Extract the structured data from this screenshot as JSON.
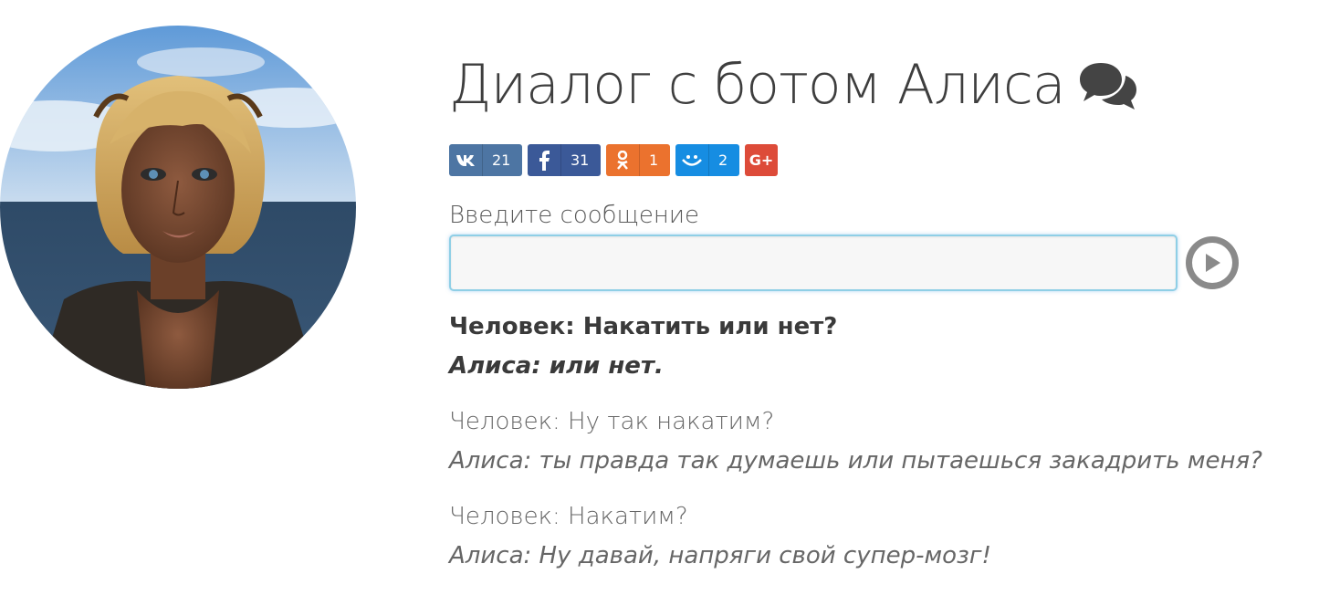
{
  "header": {
    "title": "Диалог с ботом Алиса",
    "title_icon": "comments-icon"
  },
  "share": [
    {
      "network": "vk",
      "icon": "vk-icon",
      "count": "21",
      "color": "#4d75a3"
    },
    {
      "network": "facebook",
      "icon": "facebook-icon",
      "count": "31",
      "color": "#3b5998"
    },
    {
      "network": "odnoklassniki",
      "icon": "odnoklassniki-icon",
      "count": "1",
      "color": "#eb722e"
    },
    {
      "network": "moimir",
      "icon": "moimir-icon",
      "count": "2",
      "color": "#168de2"
    },
    {
      "network": "googleplus",
      "icon": "googleplus-icon",
      "label": "G+",
      "color": "#dd4b39"
    }
  ],
  "input": {
    "label": "Введите сообщение",
    "value": "",
    "placeholder": ""
  },
  "send_button": {
    "icon": "play-icon"
  },
  "dialog": [
    {
      "human": "Человек: Накатить или нет?",
      "bot": "Алиса: или нет."
    },
    {
      "human": "Человек: Ну так накатим?",
      "bot": "Алиса: ты правда так думаешь или пытаешься закадрить меня?"
    },
    {
      "human": "Человек: Накатим?",
      "bot": "Алиса: Ну давай, напряги свой супер-мозг!"
    }
  ]
}
